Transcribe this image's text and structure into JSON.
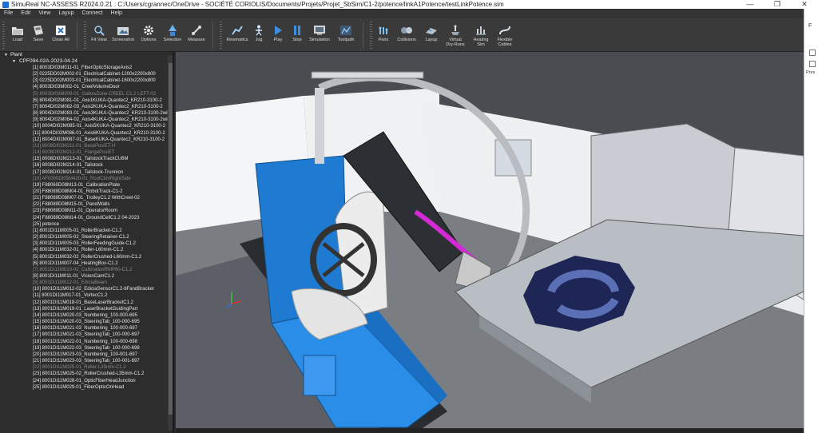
{
  "window": {
    "title": "SimuReal NC-ASSESS R2024.0.21 : C:/Users/cgrannec/OneDrive - SOCIÉTÉ CORIOLIS/Documents/Projets/Projet_SbSim/C1-2/potence/linkA1Potence/testLinkPotence.sim"
  },
  "menu": [
    "File",
    "Edit",
    "View",
    "Layup",
    "Connect",
    "Help"
  ],
  "toolbar": [
    {
      "label": "Load",
      "icon": "folder-icon"
    },
    {
      "label": "Save",
      "icon": "save-icon"
    },
    {
      "label": "Close All",
      "icon": "close-all-icon"
    },
    {
      "label": "Fit View",
      "icon": "fit-view-icon"
    },
    {
      "label": "Screenshot",
      "icon": "screenshot-icon"
    },
    {
      "label": "Options",
      "icon": "gear-icon"
    },
    {
      "label": "Selection",
      "icon": "selection-icon"
    },
    {
      "label": "Measure",
      "icon": "measure-icon"
    },
    {
      "label": "Kinematics",
      "icon": "kinematics-icon"
    },
    {
      "label": "Jog",
      "icon": "jog-icon"
    },
    {
      "label": "Play",
      "icon": "play-icon"
    },
    {
      "label": "Stop",
      "icon": "stop-icon"
    },
    {
      "label": "Simulation",
      "icon": "simulation-icon"
    },
    {
      "label": "Toolpath",
      "icon": "toolpath-icon"
    },
    {
      "label": "Pairs",
      "icon": "pairs-icon"
    },
    {
      "label": "Collisions",
      "icon": "collisions-icon"
    },
    {
      "label": "Layup",
      "icon": "layup-icon"
    },
    {
      "label": "Virtual\nDry-Runs",
      "icon": "dry-run-icon"
    },
    {
      "label": "Heating\nSim",
      "icon": "heating-icon"
    },
    {
      "label": "Flexible\nCables",
      "icon": "cables-icon"
    }
  ],
  "tree": {
    "root": "Plant",
    "project": "CPF094-02A-2023-04-24",
    "items": [
      {
        "text": "[1] 8003DI03M011-01_FiberOpticStorageAxis2",
        "dim": false
      },
      {
        "text": "[2] 0225DD02M002-01_ElectricalCabinet-1200x2200x800",
        "dim": false
      },
      {
        "text": "[3] 0225DD02M003-01_ElectricalCabinet-1600x2200x800",
        "dim": false
      },
      {
        "text": "[4] 8003DI03M002-01_CreelVolumeDoor",
        "dim": false
      },
      {
        "text": "[5] 8003DI03M009-01_GallowZone-CREEL C1.2 LEFT-02",
        "dim": true
      },
      {
        "text": "[6] 8004DI02M081-01_Axe1KUKA-Quantec2_KR210-3100-2",
        "dim": false
      },
      {
        "text": "[7] 8004DI02M082-03_Axis2KUKA-Quantec2_KR210-3100-2",
        "dim": false
      },
      {
        "text": "[8] 8004DI02M083-01_Axis3KUKA-Quantec2_KR210-3100-2wit",
        "dim": false
      },
      {
        "text": "[9] 8004DI02M084-02_Axis4KUKA-Quantec2_KR210-3100-2wit",
        "dim": false
      },
      {
        "text": "[10] 8004DI02M085-01_Axis5KUKA-Quantec2_KR210-3100-2",
        "dim": false
      },
      {
        "text": "[11] 8004DI02M086-01_Axis6KUKA-Quantec2_KR210-3100-2",
        "dim": false
      },
      {
        "text": "[12] 8004DI02M087-01_BaseKUKA-Quantec2_KR210-3100-2",
        "dim": false
      },
      {
        "text": "[13] 8008DI02M211-01_BasePosiET-H",
        "dim": true
      },
      {
        "text": "[14] 8008DI02M212-01_FlangePosiET",
        "dim": true
      },
      {
        "text": "[15] 8008DI02M213-01_TailstockTrackCU6M",
        "dim": false
      },
      {
        "text": "[16] 8008DI02M214-01_Tailstock",
        "dim": false
      },
      {
        "text": "[17] 8008DI02M214-01_Tailstock-Trunnion",
        "dim": false
      },
      {
        "text": "[18] AF0000DI05M420-01_RoofClimRightSide",
        "dim": true
      },
      {
        "text": "[19] F88060D08M13-01_CalibrationPlate",
        "dim": false
      },
      {
        "text": "[20] F88089D08M04-01_RobotTrack-C1-2",
        "dim": false
      },
      {
        "text": "[21] F88089D08M07-01_TrolleyC1.2 WithCreel-02",
        "dim": false
      },
      {
        "text": "[22] F88089D08M15-01_PanelWalls",
        "dim": false
      },
      {
        "text": "[23] F88089D08M11-01_OperatorRoom",
        "dim": false
      },
      {
        "text": "[24] F88089D08M14-01_GroundCellC1.2 04-2023",
        "dim": false
      },
      {
        "text": "[25] potence",
        "dim": false
      },
      {
        "text": "[1] 8001DI11M005-01_RollerBracket-C1.2",
        "dim": false
      },
      {
        "text": "[2] 8001DI11M005-02_SteeringRetainer-C1.2",
        "dim": false
      },
      {
        "text": "[3] 8001DI11M005-03_RollerFeedingGuide-C1.2",
        "dim": false
      },
      {
        "text": "[4] 8001DI11M032-01_Roller-L60mm-C1.2",
        "dim": false
      },
      {
        "text": "[5] 8001DI11M032-02_RollerCrushed-L60mm-C1.2",
        "dim": false
      },
      {
        "text": "[6] 8001DI11M007-04_HeatingBox-C1.2",
        "dim": false
      },
      {
        "text": "[7] 8001DI11M010-02_CalibrationRMP60-C1.2",
        "dim": true
      },
      {
        "text": "[8] 8001DI11M011-01_VisionCamC1.2",
        "dim": false
      },
      {
        "text": "[9] 8001DI11M012-01_EdiciaBeam",
        "dim": true
      },
      {
        "text": "[10] 8001DI11M012-02_EdiciaSensorC1.2-8FandBracket",
        "dim": false
      },
      {
        "text": "[11] 8001DI11M017-01_VortecC1.2",
        "dim": false
      },
      {
        "text": "[12] 8001DI11M018-01_BaseLaserBracketC1.2",
        "dim": false
      },
      {
        "text": "[13] 8001DI11M019-01_LaserBracketGuidingPart",
        "dim": false
      },
      {
        "text": "[14] 8001DI11M020-03_Numbering_100-000-695",
        "dim": false
      },
      {
        "text": "[15] 8001DI11M020-03_SteeringTab_100-000-695",
        "dim": false
      },
      {
        "text": "[16] 8001DI11M021-03_Numbering_100-000-697",
        "dim": false
      },
      {
        "text": "[17] 8001DI11M021-03_SteeringTab_100-000-697",
        "dim": false
      },
      {
        "text": "[18] 8001DI11M022-01_Numbering_100-000-698",
        "dim": false
      },
      {
        "text": "[19] 8001DI11M022-03_SteeringTab_100-000-698",
        "dim": false
      },
      {
        "text": "[20] 8001DI11M023-03_Numbering_100-001-697",
        "dim": false
      },
      {
        "text": "[21] 8001DI11M023-03_SteeringTab_100-001-697",
        "dim": false
      },
      {
        "text": "[22] 8001DI11M025-01_Roller-L35mm-C1.2",
        "dim": true
      },
      {
        "text": "[23] 8001DI11M025-02_RollerCrushed-L35mm-C1.2",
        "dim": false
      },
      {
        "text": "[24] 8001DI11M028-01_OpticFiberHeadJunction",
        "dim": false
      },
      {
        "text": "[25] 8001DI11M029-01_FiberOpticOnHead",
        "dim": false
      }
    ]
  },
  "rightpanel": {
    "letter": "F",
    "text": "Pres"
  },
  "colors": {
    "accent": "#1e7fd6",
    "robot": "#e8e8e8",
    "highlight": "#d42ad6",
    "base": "#2a8ee8"
  }
}
